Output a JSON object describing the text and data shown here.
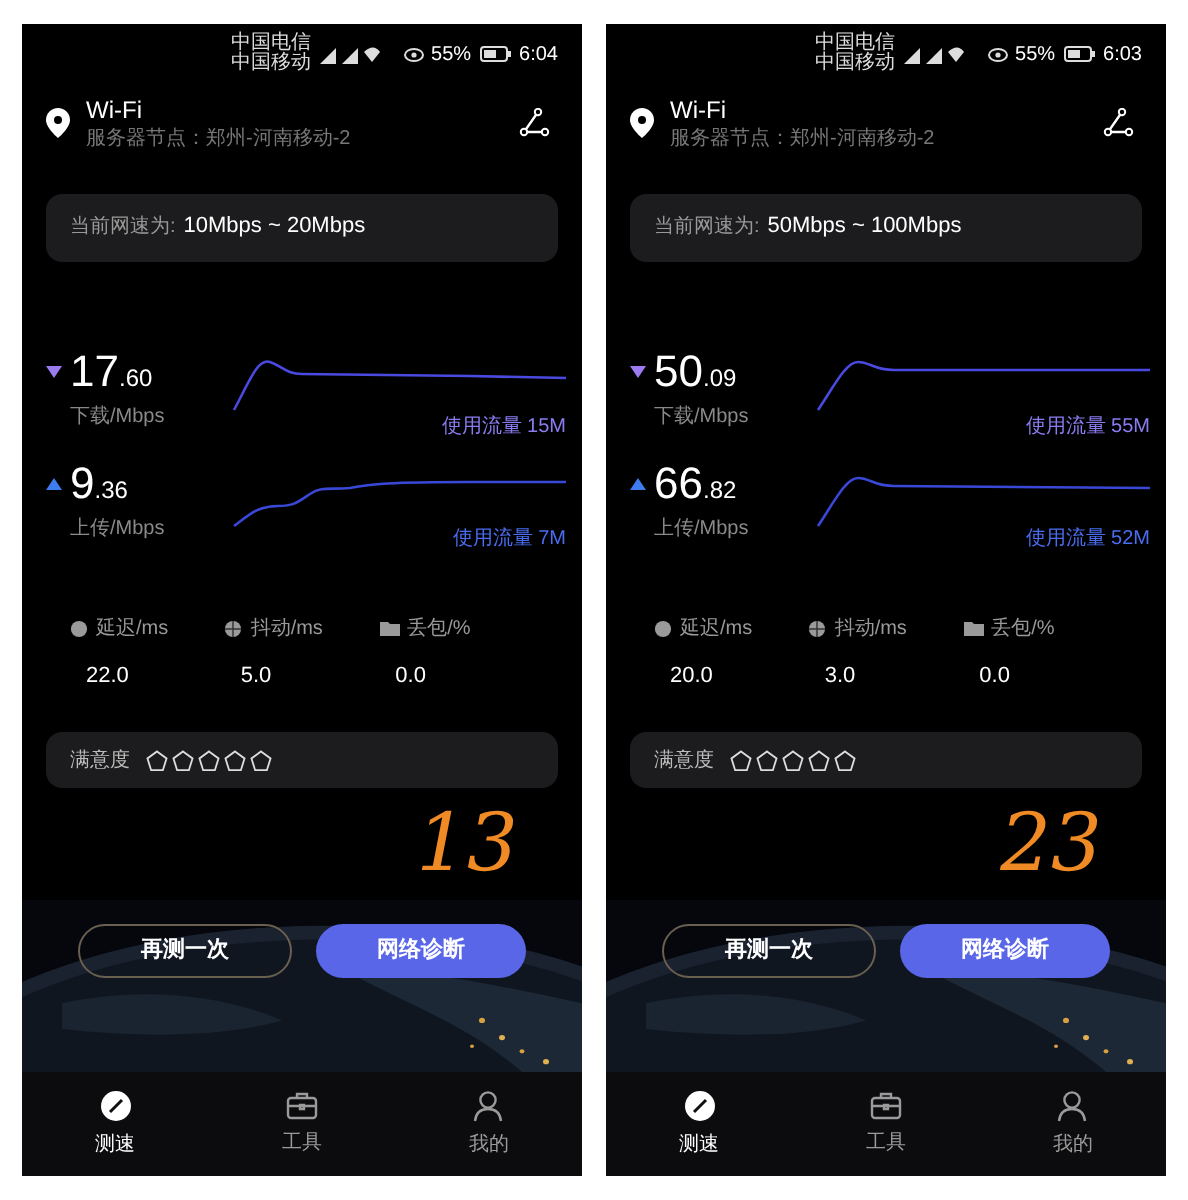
{
  "phones": [
    {
      "status_bar": {
        "carriers": [
          "中国电信",
          "中国移动"
        ],
        "battery": "55%",
        "time": "6:04"
      },
      "header": {
        "title": "Wi-Fi",
        "server": "服务器节点：郑州-河南移动-2"
      },
      "rate": {
        "label": "当前网速为:",
        "value": "10Mbps ~ 20Mbps"
      },
      "speeds": [
        {
          "kind": "download",
          "value": "17",
          "decimal": ".60",
          "label": "下载/Mbps",
          "usage": "使用流量 15M"
        },
        {
          "kind": "upload",
          "value": "9",
          "decimal": ".36",
          "label": "上传/Mbps",
          "usage": "使用流量 7M"
        }
      ],
      "metrics": [
        {
          "kind": "latency",
          "label": "延迟/ms",
          "value": "22.0"
        },
        {
          "kind": "jitter",
          "label": "抖动/ms",
          "value": "5.0"
        },
        {
          "kind": "loss",
          "label": "丢包/%",
          "value": "0.0"
        }
      ],
      "rating": {
        "label": "满意度",
        "stars": 0
      },
      "annotation": "13",
      "buttons": [
        "再测一次",
        "网络诊断"
      ],
      "tabs": [
        {
          "kind": "speed",
          "label": "测速",
          "selected": true
        },
        {
          "kind": "tools",
          "label": "工具",
          "selected": false
        },
        {
          "kind": "me",
          "label": "我的",
          "selected": false
        }
      ]
    },
    {
      "status_bar": {
        "carriers": [
          "中国电信",
          "中国移动"
        ],
        "battery": "55%",
        "time": "6:03"
      },
      "header": {
        "title": "Wi-Fi",
        "server": "服务器节点：郑州-河南移动-2"
      },
      "rate": {
        "label": "当前网速为:",
        "value": "50Mbps ~ 100Mbps"
      },
      "speeds": [
        {
          "kind": "download",
          "value": "50",
          "decimal": ".09",
          "label": "下载/Mbps",
          "usage": "使用流量 55M"
        },
        {
          "kind": "upload",
          "value": "66",
          "decimal": ".82",
          "label": "上传/Mbps",
          "usage": "使用流量 52M"
        }
      ],
      "metrics": [
        {
          "kind": "latency",
          "label": "延迟/ms",
          "value": "20.0"
        },
        {
          "kind": "jitter",
          "label": "抖动/ms",
          "value": "3.0"
        },
        {
          "kind": "loss",
          "label": "丢包/%",
          "value": "0.0"
        }
      ],
      "rating": {
        "label": "满意度",
        "stars": 0
      },
      "annotation": "23",
      "buttons": [
        "再测一次",
        "网络诊断"
      ],
      "tabs": [
        {
          "kind": "speed",
          "label": "测速",
          "selected": true
        },
        {
          "kind": "tools",
          "label": "工具",
          "selected": false
        },
        {
          "kind": "me",
          "label": "我的",
          "selected": false
        }
      ]
    }
  ]
}
